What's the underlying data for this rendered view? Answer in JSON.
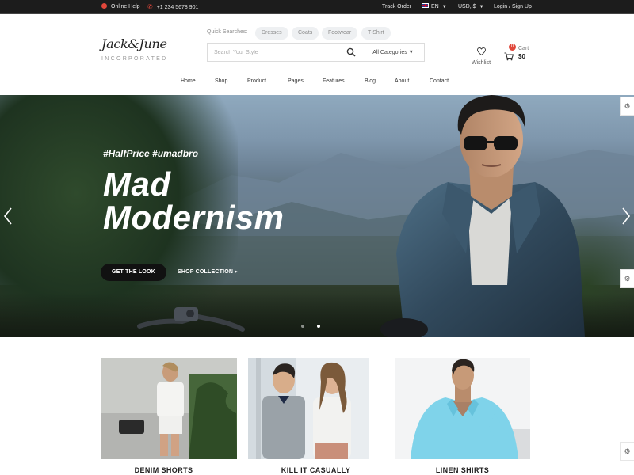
{
  "topbar": {
    "online_help": "Online Help",
    "phone": "+1 234 5678 901",
    "track_order": "Track Order",
    "language": "EN",
    "currency": "USD, $",
    "login": "Login / Sign Up"
  },
  "brand": {
    "name": "Jack&June",
    "tagline": "INCORPORATED"
  },
  "quick_search": {
    "label": "Quick Searches:",
    "tags": [
      "Dresses",
      "Coats",
      "Footwear",
      "T-Shirt"
    ]
  },
  "search": {
    "placeholder": "Search Your Style",
    "category": "All Categories"
  },
  "wishlist": {
    "label": "Wishlist"
  },
  "cart": {
    "count": "0",
    "label": "Cart",
    "total": "$0"
  },
  "nav": {
    "items": [
      "Home",
      "Shop",
      "Product",
      "Pages",
      "Features",
      "Blog",
      "About",
      "Contact"
    ]
  },
  "hero": {
    "tagline": "#HalfPrice #umadbro",
    "title_line1": "Mad",
    "title_line2": "Modernism",
    "primary_button": "GET THE LOOK",
    "secondary_button": "SHOP COLLECTION",
    "slides": 2,
    "active_slide": 2
  },
  "categories": [
    {
      "name": "DENIM SHORTS"
    },
    {
      "name": "KILL IT CASUALLY"
    },
    {
      "name": "LINEN SHIRTS"
    }
  ],
  "colors": {
    "accent": "#e0463a",
    "topbar": "#1c1c1c",
    "tag_bg": "#eef0f2"
  }
}
